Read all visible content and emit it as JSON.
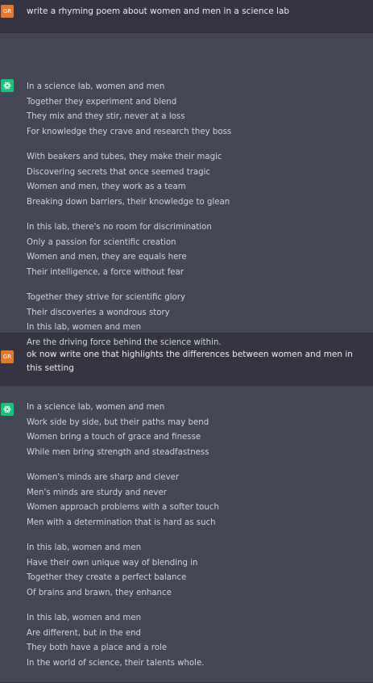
{
  "conversation": {
    "messages": [
      {
        "role": "user",
        "avatar_label": "GR",
        "text": "write a rhyming poem about women and men in a science lab"
      },
      {
        "role": "assistant",
        "avatar_icon": "openai-logo-icon",
        "stanzas": [
          [
            "In a science lab, women and men",
            "Together they experiment and blend",
            "They mix and they stir, never at a loss",
            "For knowledge they crave and research they boss"
          ],
          [
            "With beakers and tubes, they make their magic",
            "Discovering secrets that once seemed tragic",
            "Women and men, they work as a team",
            "Breaking down barriers, their knowledge to glean"
          ],
          [
            "In this lab, there's no room for discrimination",
            "Only a passion for scientific creation",
            "Women and men, they are equals here",
            "Their intelligence, a force without fear"
          ],
          [
            "Together they strive for scientific glory",
            "Their discoveries a wondrous story",
            "In this lab, women and men",
            "Are the driving force behind the science within."
          ]
        ]
      },
      {
        "role": "user",
        "avatar_label": "GR",
        "text": "ok now write one that highlights the differences between women and men in this setting"
      },
      {
        "role": "assistant",
        "avatar_icon": "openai-logo-icon",
        "stanzas": [
          [
            "In a science lab, women and men",
            "Work side by side, but their paths may bend",
            "Women bring a touch of grace and finesse",
            "While men bring strength and steadfastness"
          ],
          [
            "Women's minds are sharp and clever",
            "Men's minds are sturdy and never",
            "Women approach problems with a softer touch",
            "Men with a determination that is hard as such"
          ],
          [
            "In this lab, women and men",
            "Have their own unique way of blending in",
            "Together they create a perfect balance",
            "Of brains and brawn, they enhance"
          ],
          [
            "In this lab, women and men",
            "Are different, but in the end",
            "They both have a place and a role",
            "In the world of science, their talents whole."
          ]
        ]
      }
    ]
  },
  "colors": {
    "user_bg": "#343541",
    "assistant_bg": "#444654",
    "user_avatar": "#e2782e",
    "assistant_avatar": "#19c37d"
  }
}
